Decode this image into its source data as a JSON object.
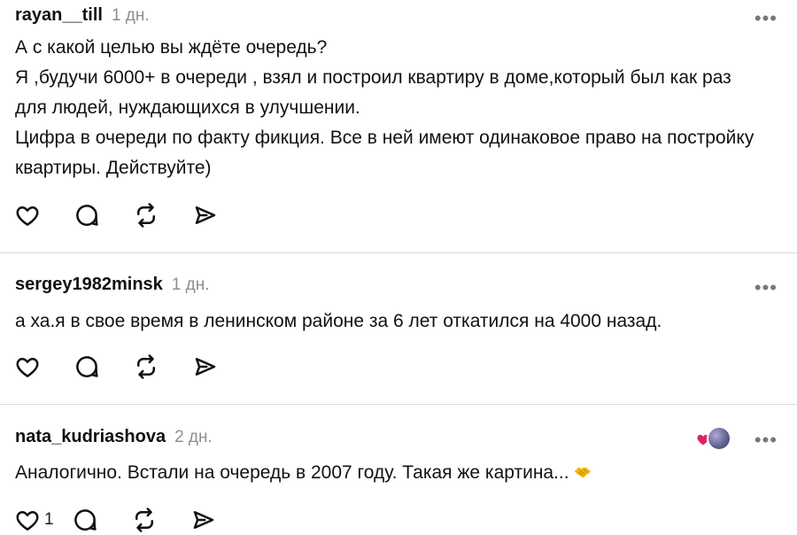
{
  "comments": [
    {
      "username": "rayan__till",
      "time": "1 дн.",
      "text": "А с какой целью вы ждёте очередь?\nЯ ,будучи 6000+ в очереди , взял и построил квартиру в доме,который был как раз для людей, нуждающихся в улучшении.\nЦифра в очереди по факту фикция. Все в ней имеют одинаковое право на постройку квартиры. Действуйте)",
      "more": "•••"
    },
    {
      "username": "sergey1982minsk",
      "time": "1 дн.",
      "text": "а ха.я в свое время в ленинском районе за 6 лет откатился на 4000 назад.",
      "more": "•••"
    },
    {
      "username": "nata_kudriashova",
      "time": "2 дн.",
      "text": "Аналогично. Встали на очередь в 2007 году. Такая же картина...",
      "more": "•••",
      "like_count": "1",
      "emoji": "handshake-emoji"
    }
  ],
  "colors": {
    "text": "#111111",
    "muted": "#8e8e8e",
    "divider": "#dbdbdb",
    "heart_red": "#e0245e",
    "emoji_yellow": "#f6b40e"
  },
  "icons": [
    "heart-icon",
    "comment-icon",
    "repost-icon",
    "share-icon",
    "more-icon"
  ]
}
